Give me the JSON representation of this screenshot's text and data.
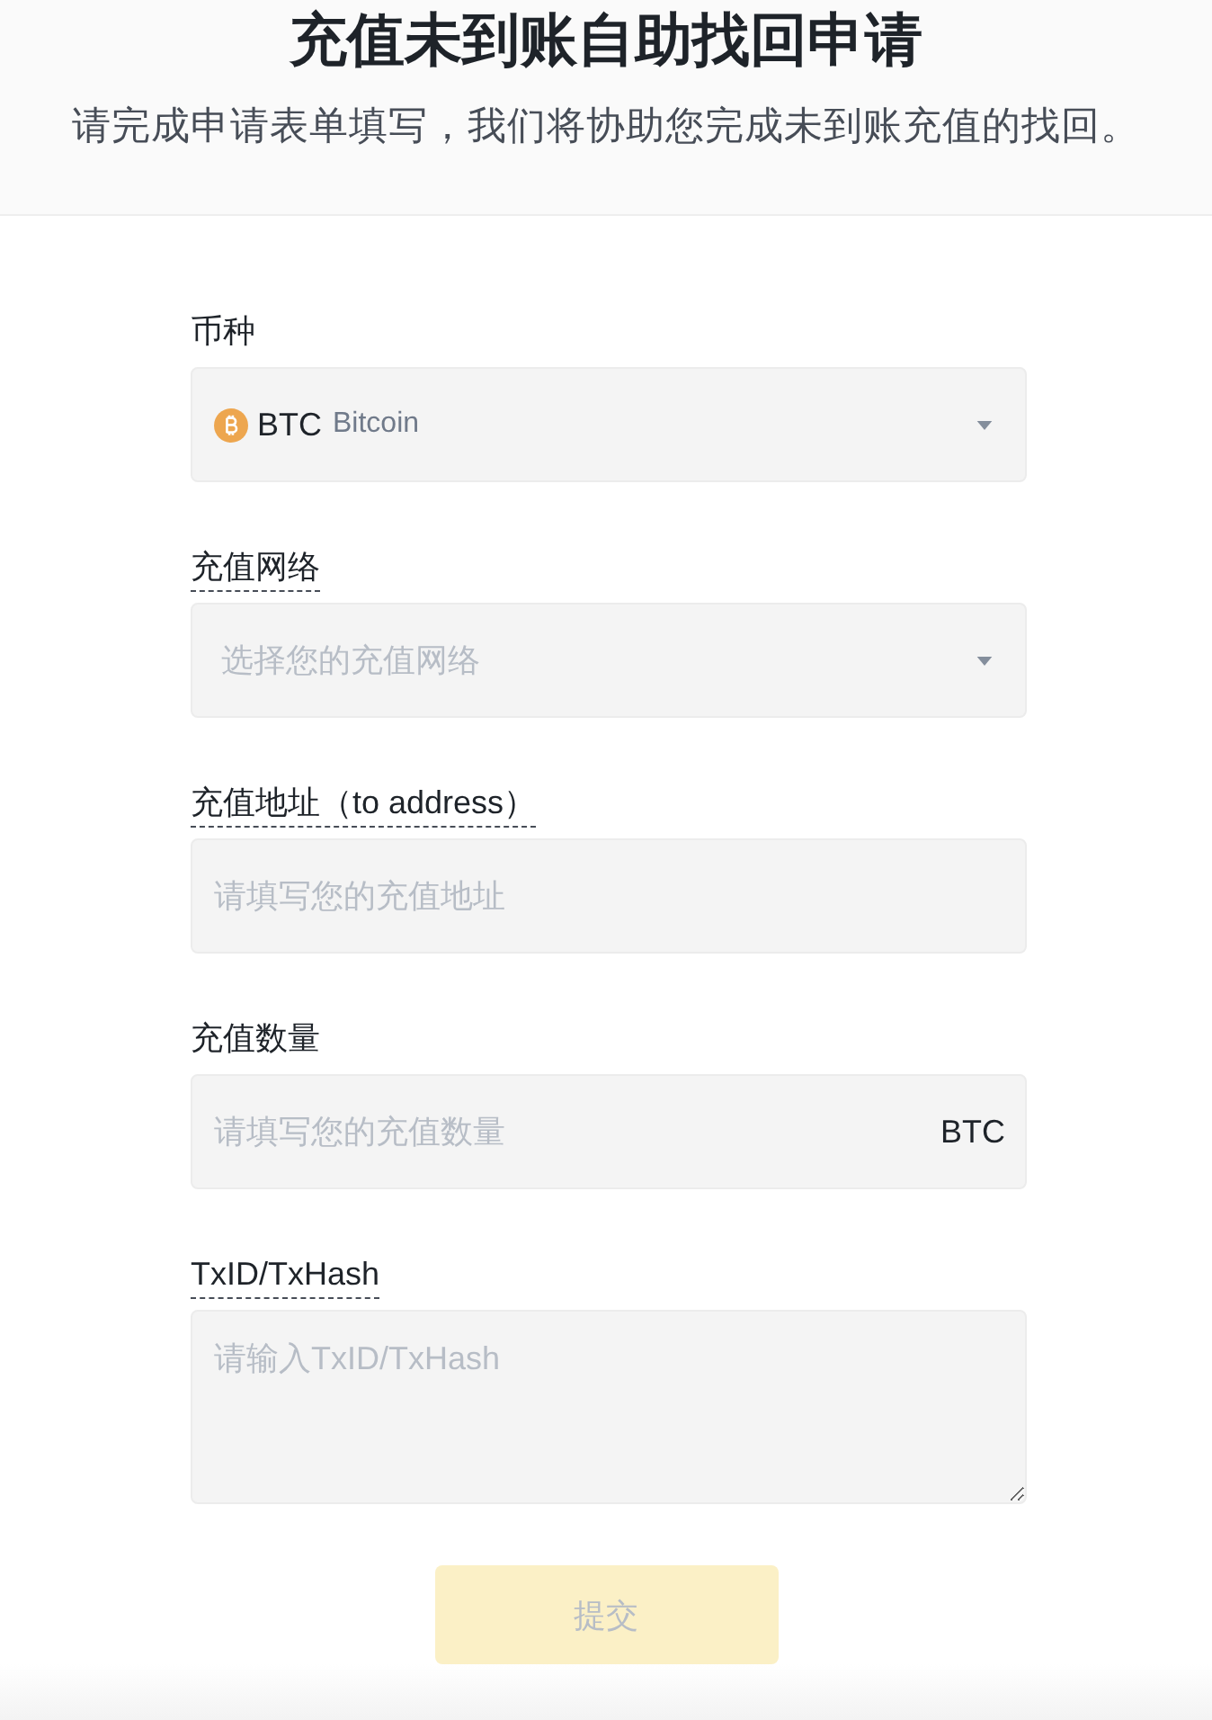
{
  "header": {
    "title": "充值未到账自助找回申请",
    "subtitle": "请完成申请表单填写，我们将协助您完成未到账充值的找回。"
  },
  "fields": [
    {
      "kind": "select",
      "label": "币种",
      "underlined": false,
      "value": "BTC",
      "value_detail": "Bitcoin"
    },
    {
      "kind": "select",
      "label": "充值网络",
      "underlined": true,
      "placeholder": "选择您的充值网络"
    },
    {
      "kind": "input",
      "label": "充值地址（to address）",
      "underlined": true,
      "placeholder": "请填写您的充值地址"
    },
    {
      "kind": "input",
      "label": "充值数量",
      "underlined": false,
      "placeholder": "请填写您的充值数量",
      "suffix": "BTC"
    },
    {
      "kind": "textarea",
      "label": "TxID/TxHash",
      "underlined": true,
      "placeholder": "请输入TxID/TxHash"
    }
  ],
  "submit": {
    "label": "提交",
    "disabled": true
  }
}
